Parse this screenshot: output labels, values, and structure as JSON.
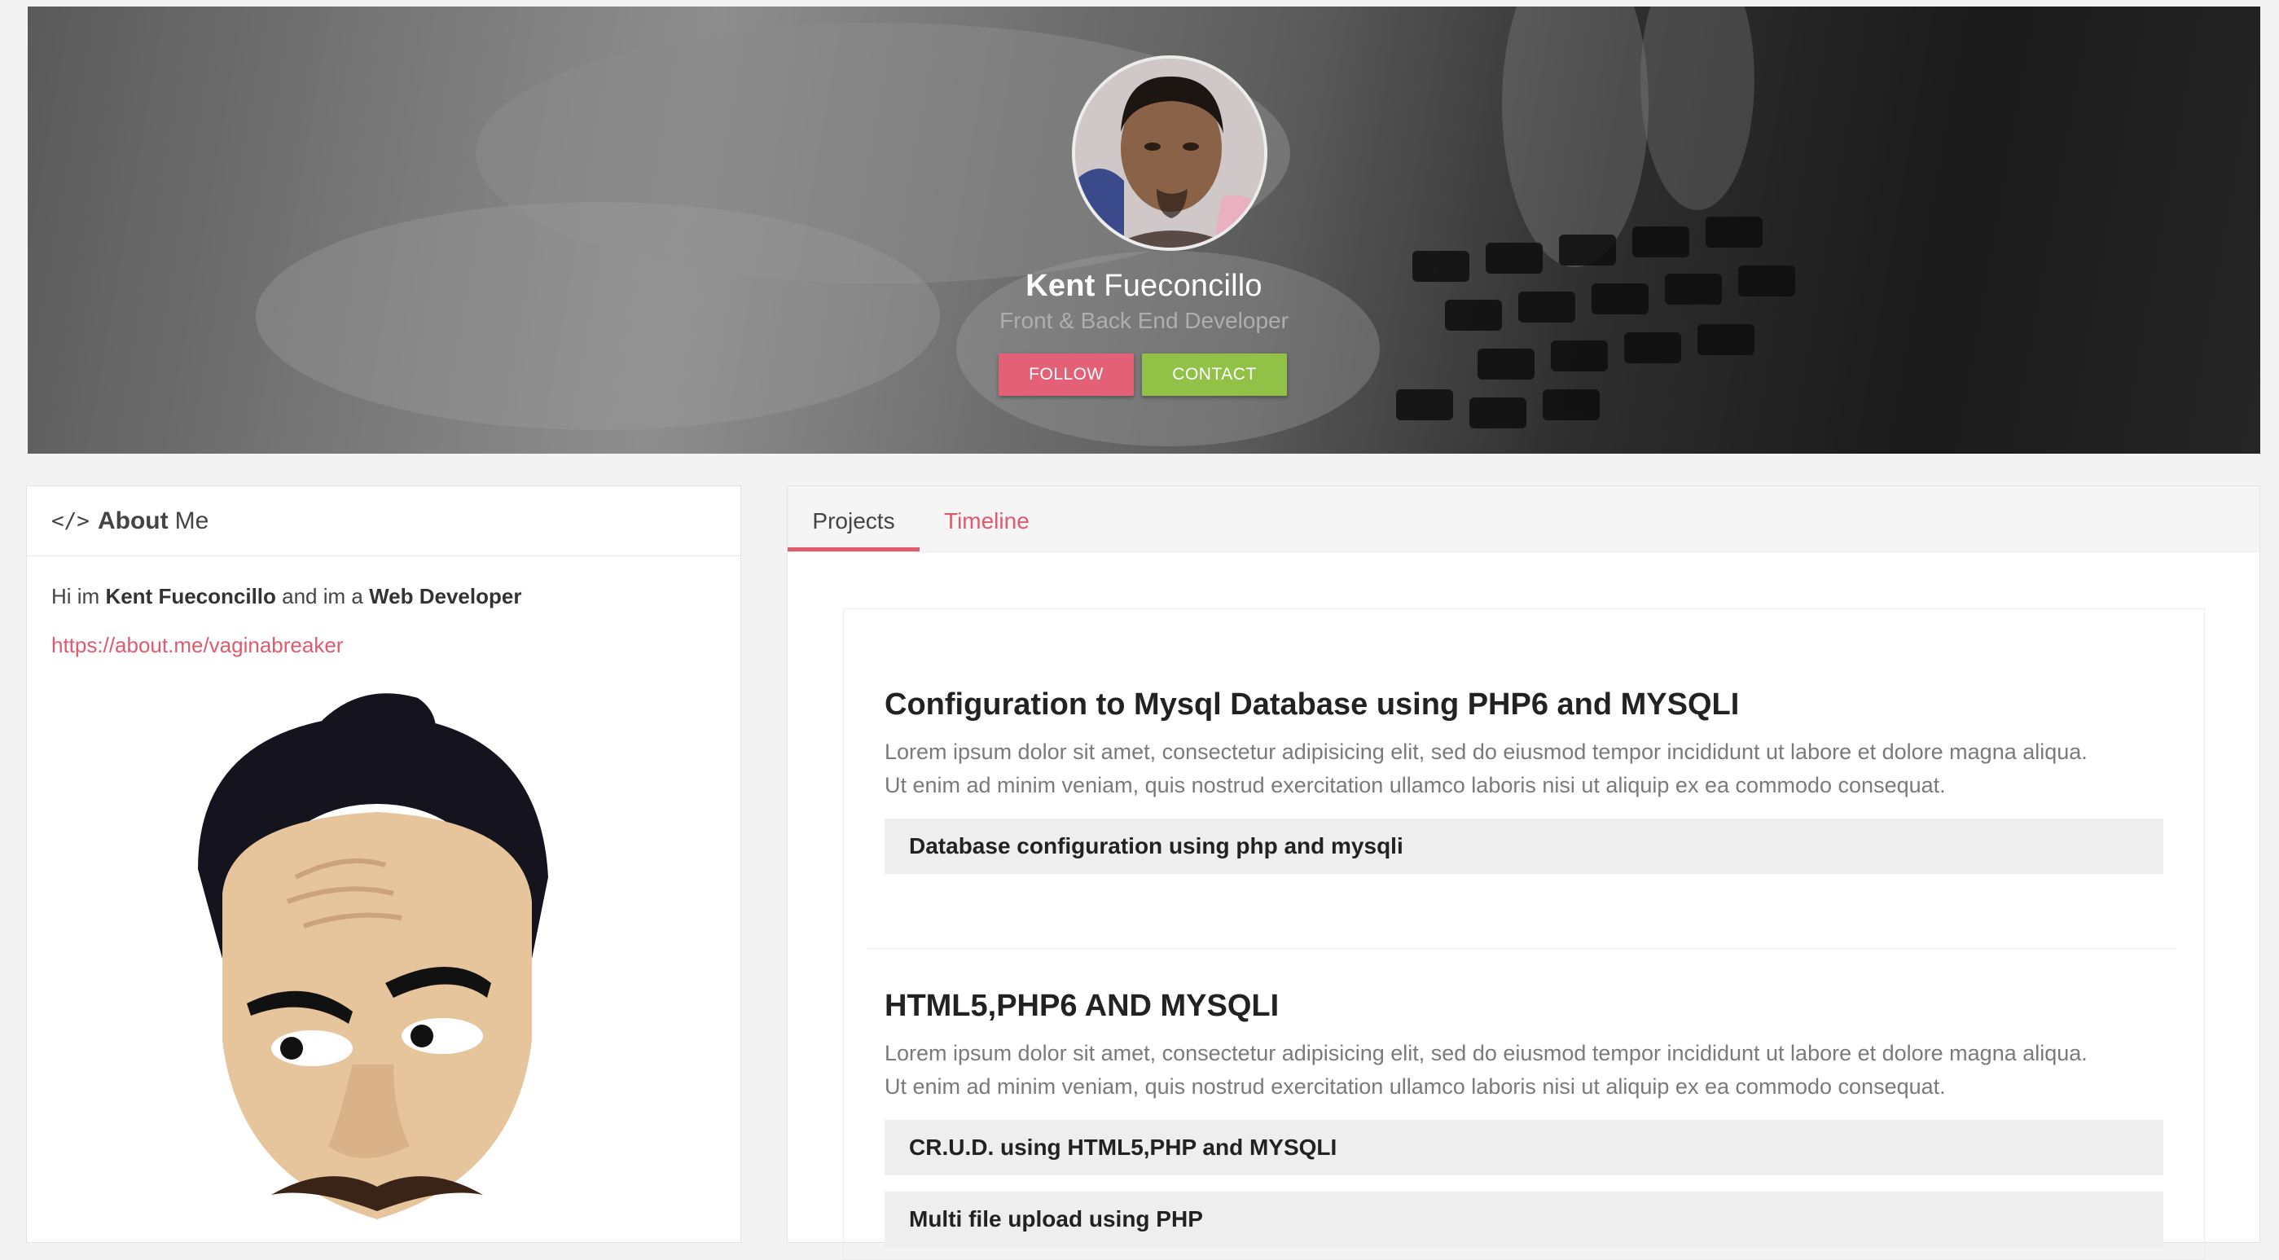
{
  "profile": {
    "first_name": "Kent",
    "last_name": "Fueconcillo",
    "role": "Front & Back End Developer",
    "follow_label": "FOLLOW",
    "contact_label": "CONTACT"
  },
  "about": {
    "title_bold": "About",
    "title_rest": "Me",
    "intro_prefix": "Hi im ",
    "intro_name": "Kent Fueconcillo",
    "intro_mid": " and im a ",
    "intro_job": "Web Developer",
    "link": "https://about.me/vaginabreaker"
  },
  "tabs": [
    {
      "label": "Projects",
      "active": true
    },
    {
      "label": "Timeline",
      "active": false
    }
  ],
  "projects": [
    {
      "title": "Configuration to Mysql Database using PHP6 and MYSQLI",
      "desc_1": "Lorem ipsum dolor sit amet, consectetur adipisicing elit, sed do eiusmod tempor incididunt ut labore et dolore magna aliqua.",
      "desc_2": "Ut enim ad minim veniam, quis nostrud exercitation ullamco laboris nisi ut aliquip ex ea commodo consequat.",
      "items": [
        "Database configuration using php and mysqli"
      ]
    },
    {
      "title": "HTML5,PHP6 AND MYSQLI",
      "desc_1": "Lorem ipsum dolor sit amet, consectetur adipisicing elit, sed do eiusmod tempor incididunt ut labore et dolore magna aliqua.",
      "desc_2": "Ut enim ad minim veniam, quis nostrud exercitation ullamco laboris nisi ut aliquip ex ea commodo consequat.",
      "items": [
        "CR.U.D. using HTML5,PHP and MYSQLI",
        "Multi file upload using PHP"
      ]
    }
  ],
  "colors": {
    "accent": "#e05a6e",
    "follow": "#e36076",
    "contact": "#92c147"
  }
}
